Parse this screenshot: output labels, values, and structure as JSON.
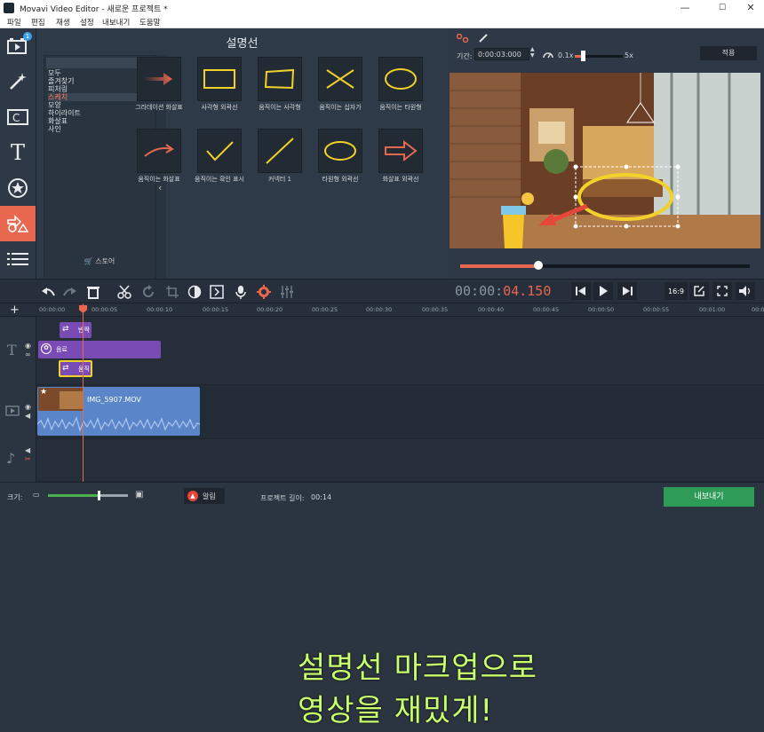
{
  "window": {
    "title": "Movavi Video Editor - 새로운 프로젝트 *",
    "minimize": "—",
    "maximize": "☐",
    "close": "✕"
  },
  "menu": [
    "파일",
    "편집",
    "재생",
    "설정",
    "내보내기",
    "도움말"
  ],
  "tools": [
    {
      "name": "import-icon",
      "badge": "1"
    },
    {
      "name": "filters-icon"
    },
    {
      "name": "transitions-icon"
    },
    {
      "name": "titles-icon",
      "glyph": "T"
    },
    {
      "name": "stickers-icon",
      "glyph": "★"
    },
    {
      "name": "callouts-icon",
      "active": true
    },
    {
      "name": "more-icon",
      "glyph": "☰"
    }
  ],
  "library": {
    "title": "설명선",
    "categories": [
      "모두",
      "즐겨찾기",
      "피처링",
      "스케치",
      "모양",
      "하이라이트",
      "화살표",
      "사인"
    ],
    "selected_category": "스케치",
    "store_label": "스토어",
    "tiles": [
      {
        "label": "그라데이션 화살표",
        "icon": "gradient-arrow"
      },
      {
        "label": "사각형 외곽선",
        "icon": "rectangle-outline"
      },
      {
        "label": "움직이는 사각형",
        "icon": "moving-rectangle"
      },
      {
        "label": "움직이는 십자가",
        "icon": "moving-cross"
      },
      {
        "label": "움직이는 타원형",
        "icon": "moving-oval"
      },
      {
        "label": "움직이는 화살표",
        "icon": "moving-arrow"
      },
      {
        "label": "움직이는 확인 표시",
        "icon": "moving-check"
      },
      {
        "label": "커넥터 1",
        "icon": "connector"
      },
      {
        "label": "타원형 외곽선",
        "icon": "oval-outline"
      },
      {
        "label": "화살표 외곽선",
        "icon": "arrow-outline"
      }
    ]
  },
  "preview": {
    "duration_label": "기간:",
    "duration_value": "0:00:03:000",
    "speed_min": "0.1x",
    "speed_max": "5x",
    "apply_label": "적용",
    "progress": 0.27
  },
  "playback": {
    "time_dim": "00:00:",
    "time_hl": "04.150",
    "aspect": "16:9"
  },
  "ruler": [
    "00:00:00",
    "00:00:05",
    "00:00:10",
    "00:00:15",
    "00:00:20",
    "00:00:25",
    "00:00:30",
    "00:00:35",
    "00:00:40",
    "00:00:45",
    "00:00:50",
    "00:00:55",
    "00:01:00",
    "00:01:0"
  ],
  "timeline": {
    "clips": [
      {
        "label": "반짝"
      },
      {
        "label": "음료"
      },
      {
        "label": "움직"
      }
    ],
    "video_clip": "IMG_5907.MOV"
  },
  "caption": [
    "설명선 마크업으로",
    "영상을 재밌게!"
  ],
  "status": {
    "zoom_label": "크기:",
    "alert_label": "알림",
    "project_length_label": "프로젝트 길이:",
    "project_length": "00:14",
    "export_label": "내보내기",
    "zoom_level": 0.64
  },
  "colors": {
    "accent": "#e8674f",
    "tile_yellow": "#f2d22a",
    "caption": "#c9ff6a",
    "export": "#2e9c58"
  }
}
